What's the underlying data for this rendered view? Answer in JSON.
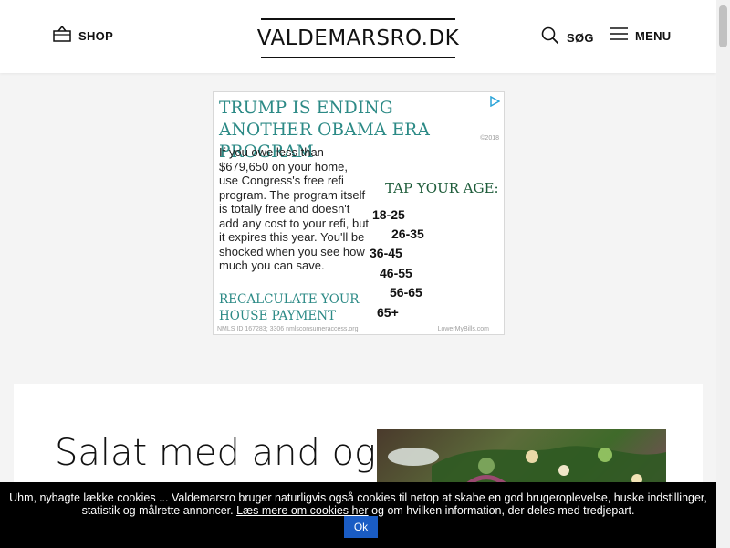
{
  "header": {
    "shop_label": "SHOP",
    "logo_text": "VALDEMARSRO.DK",
    "search_label": "SØG",
    "menu_label": "MENU"
  },
  "icons": [
    "basket-icon",
    "search-icon",
    "hamburger-menu-icon",
    "adchoices-icon"
  ],
  "ad": {
    "headline": "Trump is ending another Obama era program",
    "copyright": "©2018",
    "body": "If you owe less than $679,650 on your home, use Congress's free refi program. The program itself is totally free and doesn't add any cost to your refi, but it expires this year. You'll be shocked when you see how much you can save.",
    "cta": "Recalculate your house payment",
    "tap_label": "Tap your age:",
    "ages": [
      "18-25",
      "26-35",
      "36-45",
      "46-55",
      "56-65",
      "65+"
    ],
    "footer_left": "NMLS ID 167283; 3306    nmlsconsumeraccess.org",
    "footer_right": "LowerMyBills.com"
  },
  "article": {
    "title": "Salat med and og"
  },
  "cookie_bar": {
    "text_before": "Uhm, nybagte lække cookies ... Valdemarsro bruger naturligvis også cookies til netop at skabe en god brugeroplevelse, huske indstillinger, statistik og målrette annoncer. ",
    "link_text": "Læs mere om cookies her",
    "text_after": " og om hvilken information, der deles med tredjepart.",
    "ok_label": "Ok"
  },
  "colors": {
    "ad_teal": "#2c8a86",
    "ad_green": "#1e5c3a",
    "ok_button": "#1a5cc4",
    "cookie_bg": "#000000",
    "page_bg": "#f4f4f4"
  }
}
